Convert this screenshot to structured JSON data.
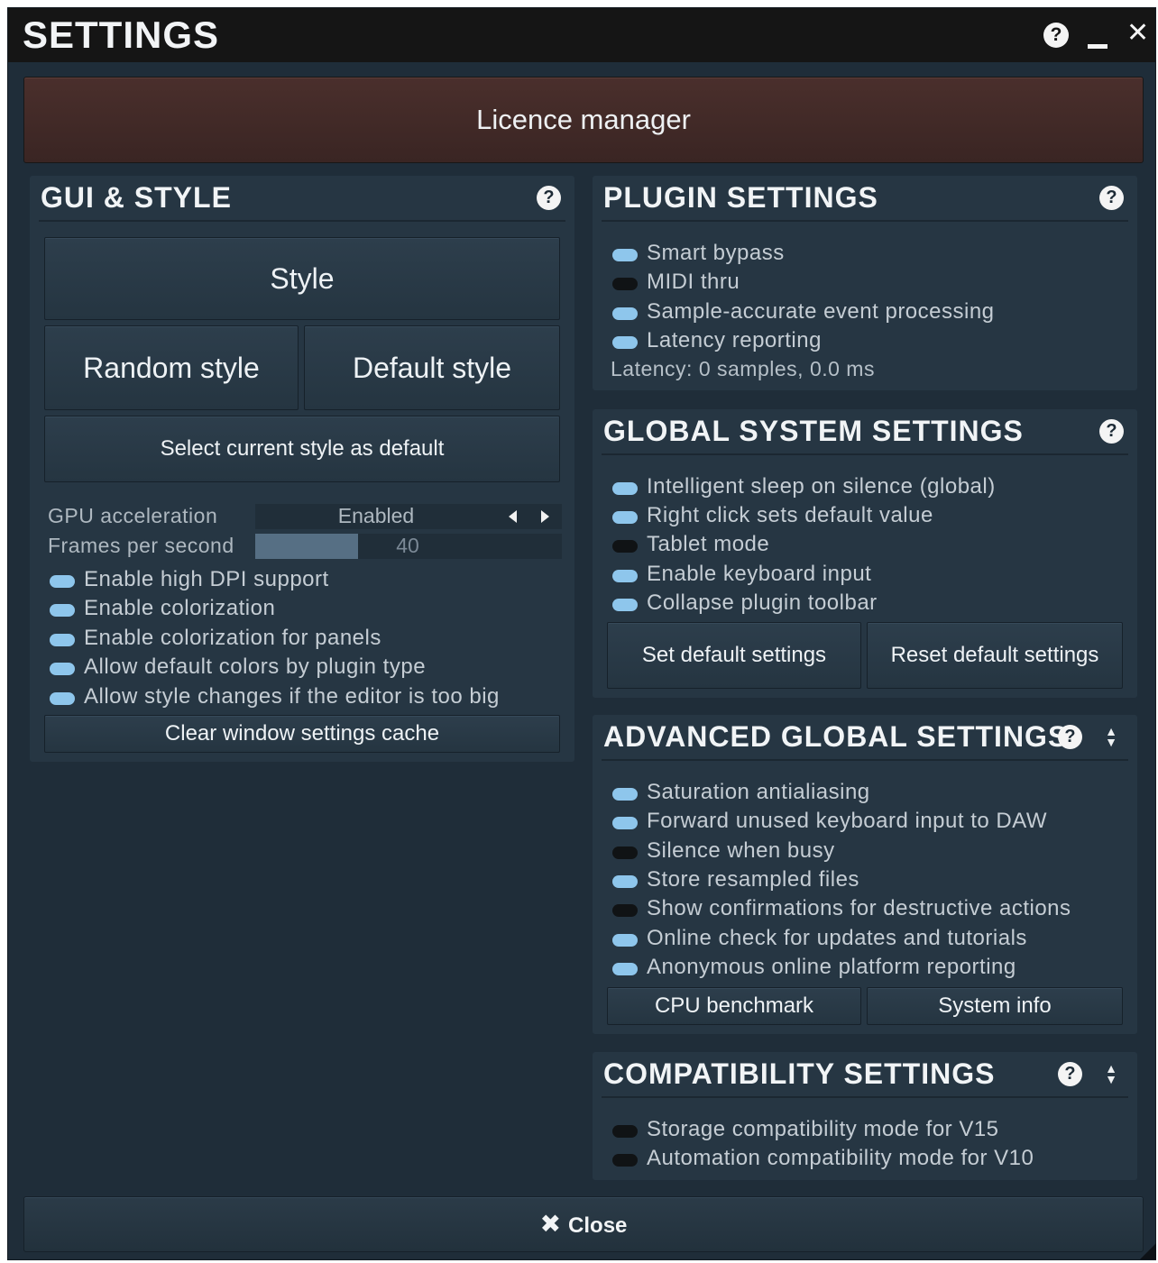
{
  "window": {
    "title": "SETTINGS",
    "help_glyph": "?",
    "close_glyph": "✕"
  },
  "licence": {
    "label": "Licence manager"
  },
  "gui_style": {
    "title": "GUI & STYLE",
    "help_glyph": "?",
    "style_button": "Style",
    "random_style_button": "Random style",
    "default_style_button": "Default style",
    "select_default_button": "Select current style as default",
    "gpu": {
      "label": "GPU acceleration",
      "value": "Enabled"
    },
    "fps": {
      "label": "Frames per second",
      "value": "40",
      "fill_fraction": 0.335
    },
    "toggles": [
      {
        "label": "Enable high DPI support",
        "on": true
      },
      {
        "label": "Enable colorization",
        "on": true
      },
      {
        "label": "Enable colorization for panels",
        "on": true
      },
      {
        "label": "Allow default colors by plugin type",
        "on": true
      },
      {
        "label": "Allow style changes if the editor is too big",
        "on": true
      }
    ],
    "clear_cache_button": "Clear window settings cache"
  },
  "plugin_settings": {
    "title": "PLUGIN SETTINGS",
    "help_glyph": "?",
    "toggles": [
      {
        "label": "Smart bypass",
        "on": true
      },
      {
        "label": "MIDI thru",
        "on": false
      },
      {
        "label": "Sample-accurate event processing",
        "on": true
      },
      {
        "label": "Latency reporting",
        "on": true
      }
    ],
    "latency_text": "Latency: 0 samples, 0.0 ms"
  },
  "global_system": {
    "title": "GLOBAL SYSTEM SETTINGS",
    "help_glyph": "?",
    "toggles": [
      {
        "label": "Intelligent sleep on silence (global)",
        "on": true
      },
      {
        "label": "Right click sets default value",
        "on": true
      },
      {
        "label": "Tablet mode",
        "on": false
      },
      {
        "label": "Enable keyboard input",
        "on": true
      },
      {
        "label": "Collapse plugin toolbar",
        "on": true
      }
    ],
    "set_default_button": "Set default settings",
    "reset_default_button": "Reset default settings"
  },
  "advanced_global": {
    "title": "ADVANCED GLOBAL SETTINGS",
    "help_glyph": "?",
    "toggles": [
      {
        "label": "Saturation antialiasing",
        "on": true
      },
      {
        "label": "Forward unused keyboard input to DAW",
        "on": true
      },
      {
        "label": "Silence when busy",
        "on": false
      },
      {
        "label": "Store resampled files",
        "on": true
      },
      {
        "label": "Show confirmations for destructive actions",
        "on": false
      },
      {
        "label": "Online check for updates and tutorials",
        "on": true
      },
      {
        "label": "Anonymous online platform reporting",
        "on": true
      }
    ],
    "cpu_benchmark_button": "CPU benchmark",
    "system_info_button": "System info"
  },
  "compatibility": {
    "title": "COMPATIBILITY SETTINGS",
    "help_glyph": "?",
    "toggles": [
      {
        "label": "Storage compatibility mode for V15",
        "on": false
      },
      {
        "label": "Automation compatibility mode for V10",
        "on": false
      }
    ]
  },
  "footer": {
    "close_label": "Close",
    "close_glyph": "✖"
  },
  "colors": {
    "background": "#1f2d39",
    "panel": "#263643",
    "toggle_on": "#8ec6ec",
    "toggle_off": "#101315",
    "licence_button": "#432b28"
  }
}
